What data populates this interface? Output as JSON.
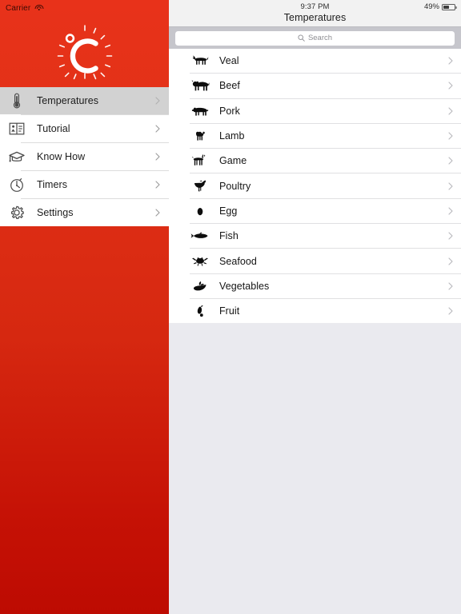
{
  "status_bar": {
    "carrier": "Carrier",
    "wifi_icon": "wifi-icon",
    "time": "9:37 PM",
    "battery_percent": "49%",
    "battery_icon": "battery-icon",
    "battery_level": 49
  },
  "sidebar": {
    "logo": {
      "icon": "degrees-celsius-sun-icon",
      "letter": "C",
      "degree": "°"
    },
    "background_color": "#e03018",
    "selected_color": "#d2d2d2",
    "items": [
      {
        "label": "Temperatures",
        "icon": "thermometer-icon",
        "selected": true,
        "chevron": "chevron-right-icon"
      },
      {
        "label": "Tutorial",
        "icon": "open-book-icon",
        "selected": false,
        "chevron": "chevron-right-icon"
      },
      {
        "label": "Know How",
        "icon": "graduation-cap-icon",
        "selected": false,
        "chevron": "chevron-right-icon"
      },
      {
        "label": "Timers",
        "icon": "stopwatch-icon",
        "selected": false,
        "chevron": "chevron-right-icon"
      },
      {
        "label": "Settings",
        "icon": "gear-icon",
        "selected": false,
        "chevron": "chevron-right-icon"
      }
    ]
  },
  "main": {
    "title": "Temperatures",
    "search": {
      "placeholder": "Search",
      "value": "",
      "icon": "search-icon"
    },
    "list": [
      {
        "label": "Veal",
        "icon": "calf-icon",
        "chevron": "chevron-right-icon"
      },
      {
        "label": "Beef",
        "icon": "cow-icon",
        "chevron": "chevron-right-icon"
      },
      {
        "label": "Pork",
        "icon": "pig-icon",
        "chevron": "chevron-right-icon"
      },
      {
        "label": "Lamb",
        "icon": "lamb-icon",
        "chevron": "chevron-right-icon"
      },
      {
        "label": "Game",
        "icon": "deer-icon",
        "chevron": "chevron-right-icon"
      },
      {
        "label": "Poultry",
        "icon": "chicken-icon",
        "chevron": "chevron-right-icon"
      },
      {
        "label": "Egg",
        "icon": "egg-icon",
        "chevron": "chevron-right-icon"
      },
      {
        "label": "Fish",
        "icon": "fish-icon",
        "chevron": "chevron-right-icon"
      },
      {
        "label": "Seafood",
        "icon": "crab-icon",
        "chevron": "chevron-right-icon"
      },
      {
        "label": "Vegetables",
        "icon": "eggplant-icon",
        "chevron": "chevron-right-icon"
      },
      {
        "label": "Fruit",
        "icon": "pear-icon",
        "chevron": "chevron-right-icon"
      }
    ]
  }
}
